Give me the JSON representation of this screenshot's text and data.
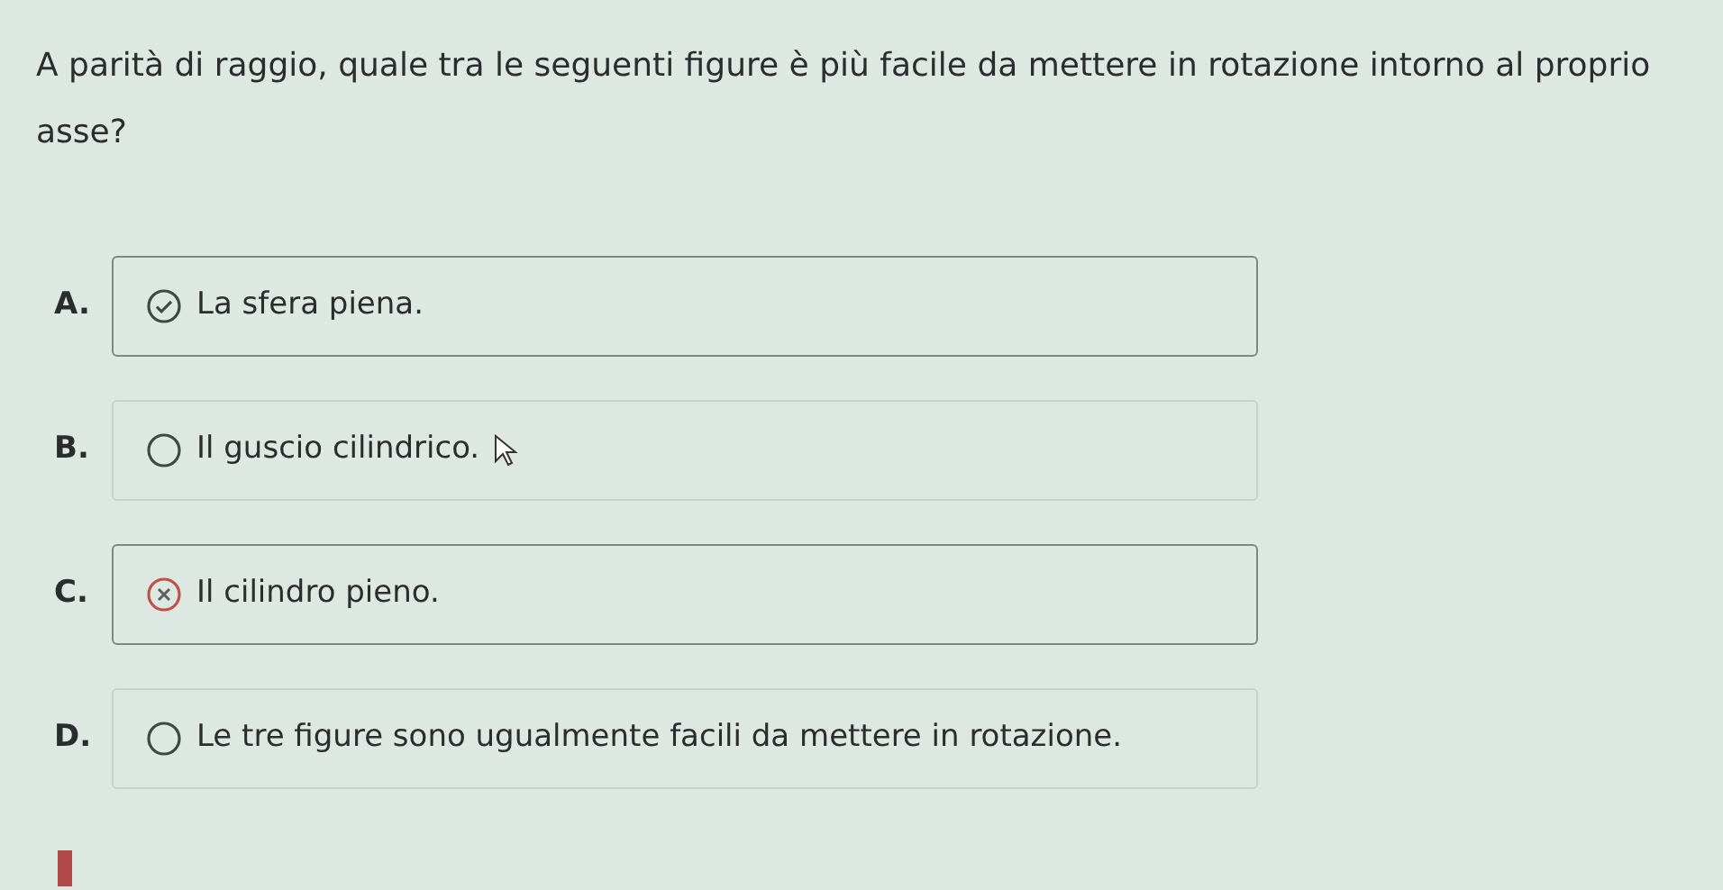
{
  "question": "A parità di raggio, quale tra le seguenti figure è più facile da mettere in rotazione intorno al proprio asse?",
  "options": [
    {
      "letter": "A.",
      "text": "La sfera piena.",
      "kind": "correct"
    },
    {
      "letter": "B.",
      "text": "Il guscio cilindrico.",
      "kind": "blank"
    },
    {
      "letter": "C.",
      "text": "Il cilindro pieno.",
      "kind": "incorrect"
    },
    {
      "letter": "D.",
      "text": "Le tre figure sono ugualmente facili da mettere in rotazione.",
      "kind": "blank"
    }
  ]
}
